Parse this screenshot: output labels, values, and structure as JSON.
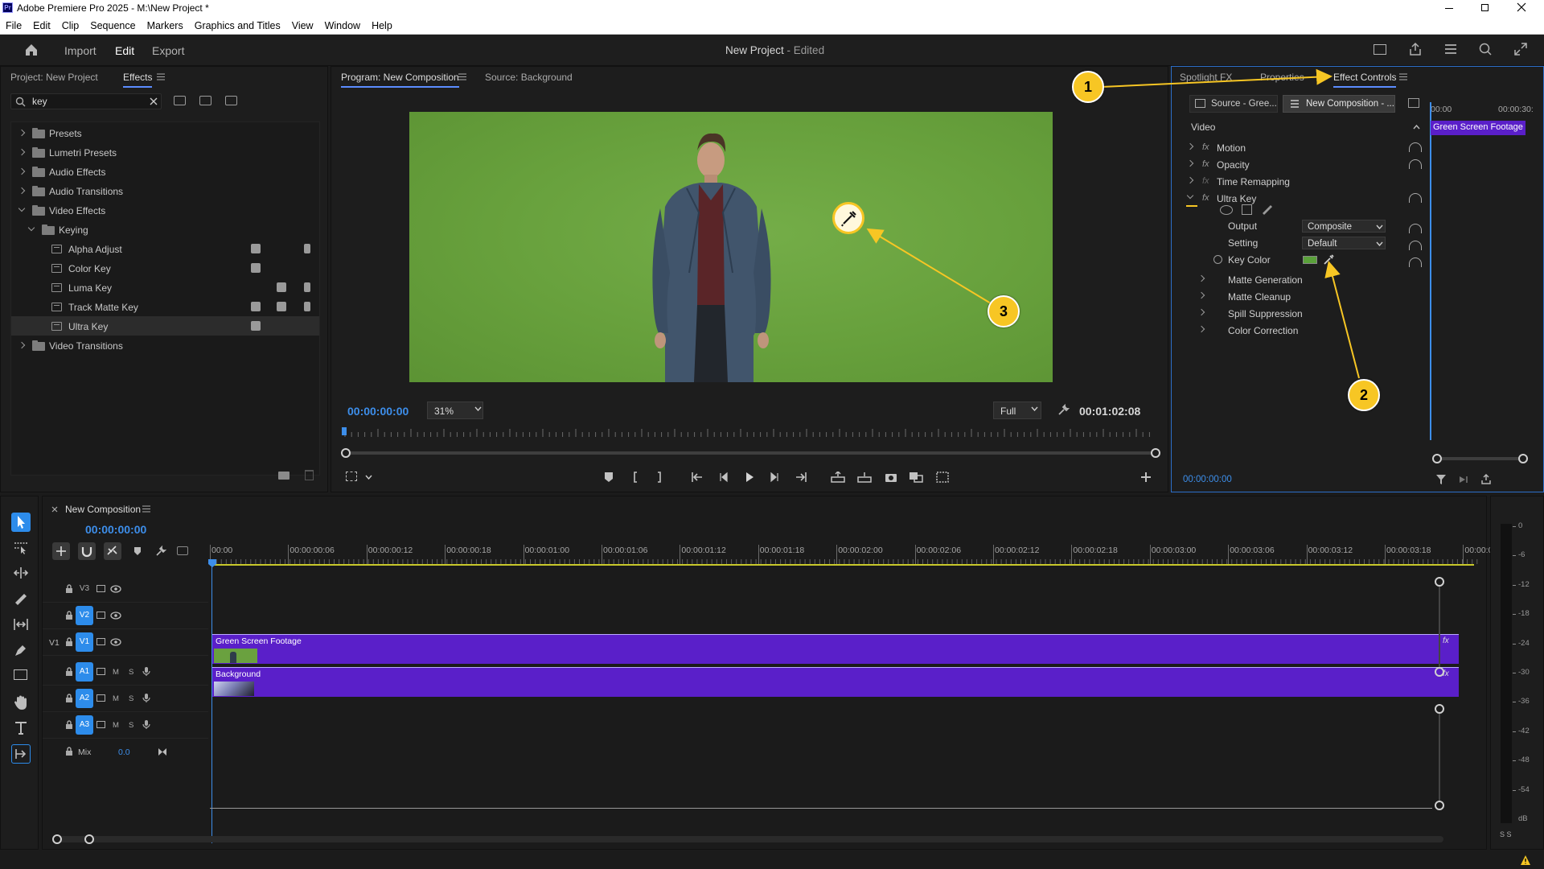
{
  "app": {
    "title": "Adobe Premiere Pro 2025 - M:\\New Project *",
    "logo": "Pr",
    "menu": [
      "File",
      "Edit",
      "Clip",
      "Sequence",
      "Markers",
      "Graphics and Titles",
      "View",
      "Window",
      "Help"
    ]
  },
  "header": {
    "home_icon": "home-icon",
    "workspaces": [
      "Import",
      "Edit",
      "Export"
    ],
    "active_workspace": "Edit",
    "project_title": "New Project",
    "project_status": "- Edited"
  },
  "effects_panel": {
    "tabs": [
      "Project: New Project",
      "Effects"
    ],
    "active_tab": "Effects",
    "search_value": "key",
    "tree": [
      {
        "label": "Presets",
        "type": "folder",
        "level": 0,
        "expanded": false
      },
      {
        "label": "Lumetri Presets",
        "type": "folder",
        "level": 0,
        "expanded": false
      },
      {
        "label": "Audio Effects",
        "type": "folder",
        "level": 0,
        "expanded": false
      },
      {
        "label": "Audio Transitions",
        "type": "folder",
        "level": 0,
        "expanded": false
      },
      {
        "label": "Video Effects",
        "type": "folder",
        "level": 0,
        "expanded": true
      },
      {
        "label": "Keying",
        "type": "folder",
        "level": 1,
        "expanded": true
      },
      {
        "label": "Alpha Adjust",
        "type": "effect",
        "level": 2
      },
      {
        "label": "Color Key",
        "type": "effect",
        "level": 2
      },
      {
        "label": "Luma Key",
        "type": "effect",
        "level": 2
      },
      {
        "label": "Track Matte Key",
        "type": "effect",
        "level": 2
      },
      {
        "label": "Ultra Key",
        "type": "effect",
        "level": 2,
        "selected": true
      },
      {
        "label": "Video Transitions",
        "type": "folder",
        "level": 0,
        "expanded": false
      }
    ]
  },
  "program_monitor": {
    "tabs": [
      "Program: New Composition",
      "Source: Background"
    ],
    "active_tab": "Program: New Composition",
    "timecode": "00:00:00:00",
    "zoom": "31%",
    "quality": "Full",
    "duration": "00:01:02:08",
    "bg_color": "#6aa13f"
  },
  "effect_controls": {
    "tabs": [
      "Spotlight FX",
      "Properties",
      "Effect Controls"
    ],
    "active_tab": "Effect Controls",
    "source_label": "Source - Gree...",
    "sequence_label": "New Composition - ...",
    "section": "Video",
    "rows": [
      {
        "label": "Motion",
        "fx": true
      },
      {
        "label": "Opacity",
        "fx": true
      },
      {
        "label": "Time Remapping",
        "fx": true
      },
      {
        "label": "Ultra Key",
        "fx": true,
        "expanded": true
      }
    ],
    "output_label": "Output",
    "output_value": "Composite",
    "setting_label": "Setting",
    "setting_value": "Default",
    "key_color_label": "Key Color",
    "key_color_swatch": "#5aa13a",
    "subsections": [
      "Matte Generation",
      "Matte Cleanup",
      "Spill Suppression",
      "Color Correction"
    ],
    "timeline_start": "00:00",
    "timeline_end": "00:00:30:",
    "clip_label": "Green Screen Footage",
    "timecode": "00:00:00:00"
  },
  "timeline": {
    "sequence_name": "New Composition",
    "timecode": "00:00:00:00",
    "ruler": [
      "00:00",
      "00:00:00:06",
      "00:00:00:12",
      "00:00:00:18",
      "00:00:01:00",
      "00:00:01:06",
      "00:00:01:12",
      "00:00:01:18",
      "00:00:02:00",
      "00:00:02:06",
      "00:00:02:12",
      "00:00:02:18",
      "00:00:03:00",
      "00:00:03:06",
      "00:00:03:12",
      "00:00:03:18",
      "00:00:0"
    ],
    "video_tracks": [
      {
        "name": "V3",
        "active": false
      },
      {
        "name": "V2",
        "active": true,
        "clip": "Green Screen Footage"
      },
      {
        "name": "V1",
        "active": true,
        "source": "V1",
        "clip": "Background"
      }
    ],
    "audio_tracks": [
      {
        "name": "A1",
        "m": "M",
        "s": "S"
      },
      {
        "name": "A2",
        "m": "M",
        "s": "S"
      },
      {
        "name": "A3",
        "m": "M",
        "s": "S"
      }
    ],
    "mix_label": "Mix",
    "mix_value": "0.0",
    "clip_color": "#5a1fc9",
    "fx_label": "fx"
  },
  "audio_meter": {
    "labels": [
      "0",
      "-6",
      "-12",
      "-18",
      "-24",
      "-30",
      "-36",
      "-42",
      "-48",
      "-54",
      "dB"
    ],
    "solo": "S S"
  },
  "callouts": [
    "1",
    "2",
    "3"
  ],
  "callout_color": "#f7c624",
  "accent": "#2d8ceb"
}
